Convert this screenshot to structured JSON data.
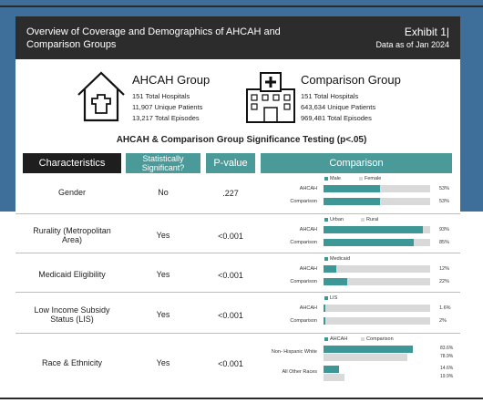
{
  "colors": {
    "teal": "#4a9a99",
    "bar": "#3c9796",
    "bar_bg": "#d9d9d9",
    "dark": "#1e1e1e",
    "header": "#2c2c2c"
  },
  "header": {
    "title": "Overview of Coverage and Demographics of AHCAH and Comparison Groups",
    "exhibit": "Exhibit 1|",
    "as_of": "Data as of Jan 2024"
  },
  "groups": [
    {
      "name": "AHCAH Group",
      "icon": "house-icon",
      "stats": [
        "151 Total Hospitals",
        "11,907 Unique Patients",
        "13,217 Total Episodes"
      ]
    },
    {
      "name": "Comparison Group",
      "icon": "hospital-icon",
      "stats": [
        "151 Total Hospitals",
        "643,634 Unique Patients",
        "969,481 Total Episodes"
      ]
    }
  ],
  "section_title": "AHCAH & Comparison Group Significance Testing (p<.05)",
  "columns": [
    "Characteristics",
    "Statistically Significant?",
    "P-value",
    "Comparison"
  ],
  "rows": [
    {
      "characteristic": "Gender",
      "significant": "No",
      "p_value": ".227",
      "legend": [
        "Male",
        "Female"
      ],
      "bars": [
        {
          "label": "AHCAH",
          "value": 0.53,
          "text": "53%"
        },
        {
          "label": "Comparison",
          "value": 0.53,
          "text": "53%"
        }
      ]
    },
    {
      "characteristic": "Rurality (Metropolitan Area)",
      "significant": "Yes",
      "p_value": "<0.001",
      "legend": [
        "Urban",
        "Rural"
      ],
      "bars": [
        {
          "label": "AHCAH",
          "value": 0.93,
          "text": "93%"
        },
        {
          "label": "Comparison",
          "value": 0.85,
          "text": "85%"
        }
      ]
    },
    {
      "characteristic": "Medicaid Eligibility",
      "significant": "Yes",
      "p_value": "<0.001",
      "legend": [
        "Medicaid"
      ],
      "bars": [
        {
          "label": "AHCAH",
          "value": 0.12,
          "text": "12%"
        },
        {
          "label": "Comparison",
          "value": 0.22,
          "text": "22%"
        }
      ]
    },
    {
      "characteristic": "Low Income Subsidy Status (LIS)",
      "significant": "Yes",
      "p_value": "<0.001",
      "legend": [
        "LIS"
      ],
      "bars": [
        {
          "label": "AHCAH",
          "value": 0.016,
          "text": "1.6%"
        },
        {
          "label": "Comparison",
          "value": 0.02,
          "text": "2%"
        }
      ]
    },
    {
      "characteristic": "Race & Ethnicity",
      "significant": "Yes",
      "p_value": "<0.001",
      "legend": [
        "AHCAH",
        "Comparison"
      ],
      "race": [
        {
          "label": "Non- Hispanic White",
          "ahcah": 0.836,
          "ahcah_text": "83.6%",
          "comp": 0.789,
          "comp_text": "78.9%"
        },
        {
          "label": "All Other Races",
          "ahcah": 0.146,
          "ahcah_text": "14.6%",
          "comp": 0.199,
          "comp_text": "19.9%"
        }
      ]
    }
  ]
}
